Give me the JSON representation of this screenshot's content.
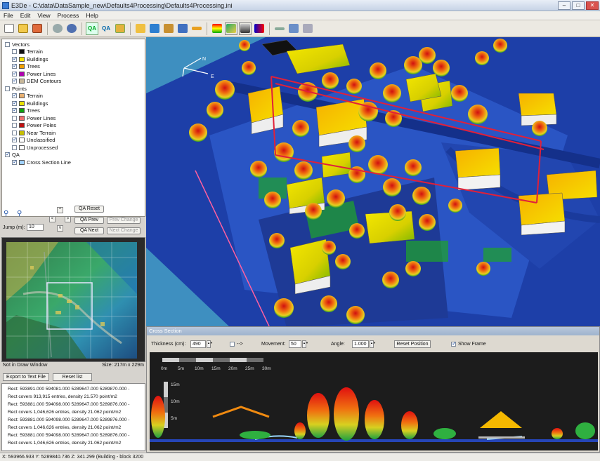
{
  "window": {
    "title": "E3De - C:\\data\\DataSample_new\\Defaults4Processing\\Defaults4Processing.ini",
    "min": "–",
    "max": "□",
    "close": "✕"
  },
  "menu": [
    "File",
    "Edit",
    "View",
    "Process",
    "Help"
  ],
  "toolbar_qa": [
    "QA",
    "QA"
  ],
  "legend": {
    "vectors_header": "Vectors",
    "vectors": [
      {
        "label": "Terrain",
        "color": "#111111",
        "checked": false
      },
      {
        "label": "Buildings",
        "color": "#f2e200",
        "checked": true
      },
      {
        "label": "Trees",
        "color": "#f0a000",
        "checked": true
      },
      {
        "label": "Power Lines",
        "color": "#b000b0",
        "checked": true
      },
      {
        "label": "DEM Contours",
        "color": "#c8b89a",
        "checked": true
      }
    ],
    "points_header": "Points",
    "points": [
      {
        "label": "Terrain",
        "color": "#e8b070",
        "checked": true
      },
      {
        "label": "Buildings",
        "color": "#e8e000",
        "checked": true
      },
      {
        "label": "Trees",
        "color": "#10a010",
        "checked": true
      },
      {
        "label": "Power Lines",
        "color": "#f07070",
        "checked": false
      },
      {
        "label": "Power Poles",
        "color": "#c01010",
        "checked": false
      },
      {
        "label": "Near Terrain",
        "color": "#c8c000",
        "checked": false
      },
      {
        "label": "Unclassified",
        "color": "#ffffff",
        "checked": true
      },
      {
        "label": "Unprocessed",
        "color": "#ffffff",
        "checked": false
      }
    ],
    "qa_header": "QA",
    "qa": [
      {
        "label": "Cross Section Line",
        "color": "#9fd0ff",
        "checked": true
      }
    ]
  },
  "nav": {
    "qa_reset": "QA Reset",
    "qa_prev": "QA Prev",
    "prev_change": "Prev Change",
    "qa_next": "QA Next",
    "next_change": "Next Change",
    "jump_label": "Jump (m):",
    "jump_value": "10",
    "arrow_up": "^",
    "arrow_down": "v",
    "arrow_left": "<",
    "arrow_right": ">"
  },
  "minimap_status": {
    "left": "Not in Draw Window",
    "right": "Size: 217m x 229m"
  },
  "log_buttons": {
    "export": "Export to Text File",
    "reset": "Reset list"
  },
  "log": [
    "Rect: 593891.000 594081.000 5289647.000 5289870.000 -",
    "Rect covers 913,915 entries, density 21.570 point/m2",
    "Rect: 593881.000 594098.000 5289647.000 5289876.000 -",
    "Rect covers 1,046,626 entries, density 21.062 point/m2",
    "Rect: 593881.000 594098.000 5289647.000 5289876.000 -",
    "Rect covers 1,046,626 entries, density 21.062 point/m2",
    "Rect: 593881.000 594098.000 5289647.000 5289876.000 -",
    "Rect covers 1,046,626 entries, density 21.062 point/m2"
  ],
  "status": "X: 593966.933 Y: 5289840.736 Z: 341.299 (Building - block 3200",
  "view3d": {
    "compass_n": "N",
    "compass_e": "E"
  },
  "cross_section": {
    "title": "Cross Section",
    "thickness_label": "Thickness (cm):",
    "thickness_value": "490",
    "arrow_text": "-->",
    "movement_label": "Movement:",
    "movement_value": "50",
    "angle_label": "Angle:",
    "angle_value": "1.000",
    "reset_button": "Reset Position",
    "show_frame_label": "Show Frame",
    "show_frame_checked": true,
    "scale_labels": [
      "0m",
      "5m",
      "10m",
      "15m",
      "20m",
      "25m",
      "30m"
    ],
    "height_labels": [
      "15m",
      "10m",
      "5m"
    ]
  }
}
